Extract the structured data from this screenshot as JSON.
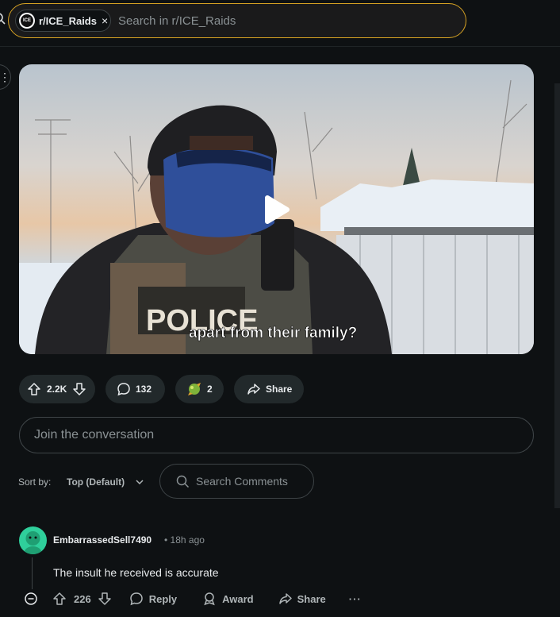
{
  "search": {
    "chip_label": "r/ICE_Raids",
    "chip_avatar_text": "ICE",
    "close_glyph": "×",
    "placeholder": "Search in r/ICE_Raids"
  },
  "post": {
    "video_caption": "apart from their family?",
    "vest_text": "POLICE"
  },
  "actions": {
    "votes": "2.2K",
    "comments": "132",
    "award_count": "2",
    "share_label": "Share"
  },
  "join": {
    "placeholder": "Join the conversation"
  },
  "sort": {
    "label": "Sort by:",
    "value": "Top (Default)",
    "search_placeholder": "Search Comments"
  },
  "comment": {
    "author": "EmbarrassedSell7490",
    "time": "• 18h ago",
    "body": "The insult he received is accurate",
    "votes": "226",
    "reply_label": "Reply",
    "award_label": "Award",
    "share_label": "Share",
    "more_glyph": "···"
  },
  "colors": {
    "background": "#0e1113",
    "accent_border": "#d6a223",
    "pill_bg": "#22292b",
    "avatar_green": "#2fcf9b"
  }
}
